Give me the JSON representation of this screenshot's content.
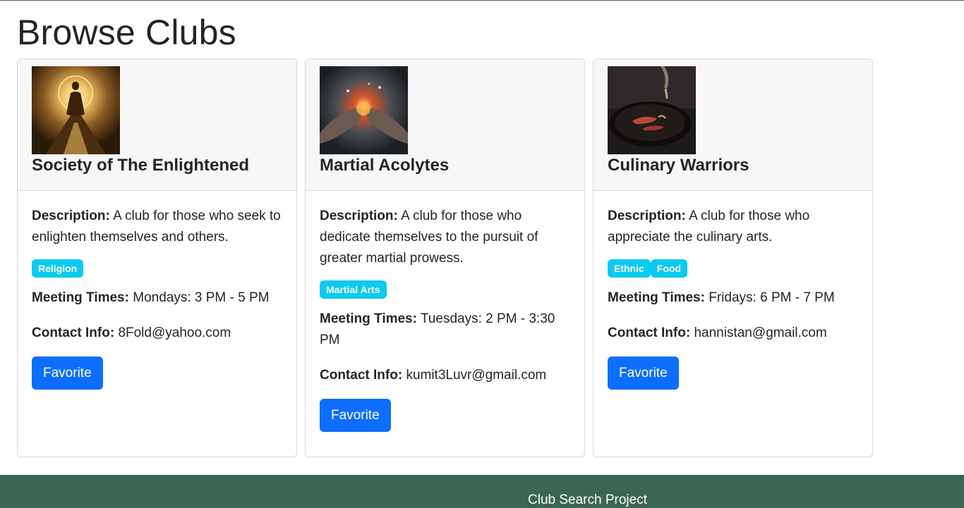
{
  "page": {
    "title": "Browse Clubs"
  },
  "clubs": [
    {
      "name": "Society of The Enlightened",
      "description_label": "Description:",
      "description": "A club for those who seek to enlighten themselves and others.",
      "tags": [
        "Religion"
      ],
      "meeting_label": "Meeting Times:",
      "meeting": "Mondays: 3 PM - 5 PM",
      "contact_label": "Contact Info:",
      "contact": "8Fold@yahoo.com",
      "button": "Favorite",
      "image_icon": "meditating-figure-image"
    },
    {
      "name": "Martial Acolytes",
      "description_label": "Description:",
      "description": "A club for those who dedicate themselves to the pursuit of greater martial prowess.",
      "tags": [
        "Martial Arts"
      ],
      "meeting_label": "Meeting Times:",
      "meeting": "Tuesdays: 2 PM - 3:30 PM",
      "contact_label": "Contact Info:",
      "contact": "kumit3Luvr@gmail.com",
      "button": "Favorite",
      "image_icon": "clashing-fists-image"
    },
    {
      "name": "Culinary Warriors",
      "description_label": "Description:",
      "description": "A club for those who appreciate the culinary arts.",
      "tags": [
        "Ethnic",
        "Food"
      ],
      "meeting_label": "Meeting Times:",
      "meeting": "Fridays: 6 PM - 7 PM",
      "contact_label": "Contact Info:",
      "contact": "hannistan@gmail.com",
      "button": "Favorite",
      "image_icon": "plated-dish-image"
    }
  ],
  "footer": {
    "text": "Club Search Project"
  },
  "colors": {
    "accent": "#0d6efd",
    "tag": "#0dcaf0",
    "footer": "#3b6651"
  }
}
